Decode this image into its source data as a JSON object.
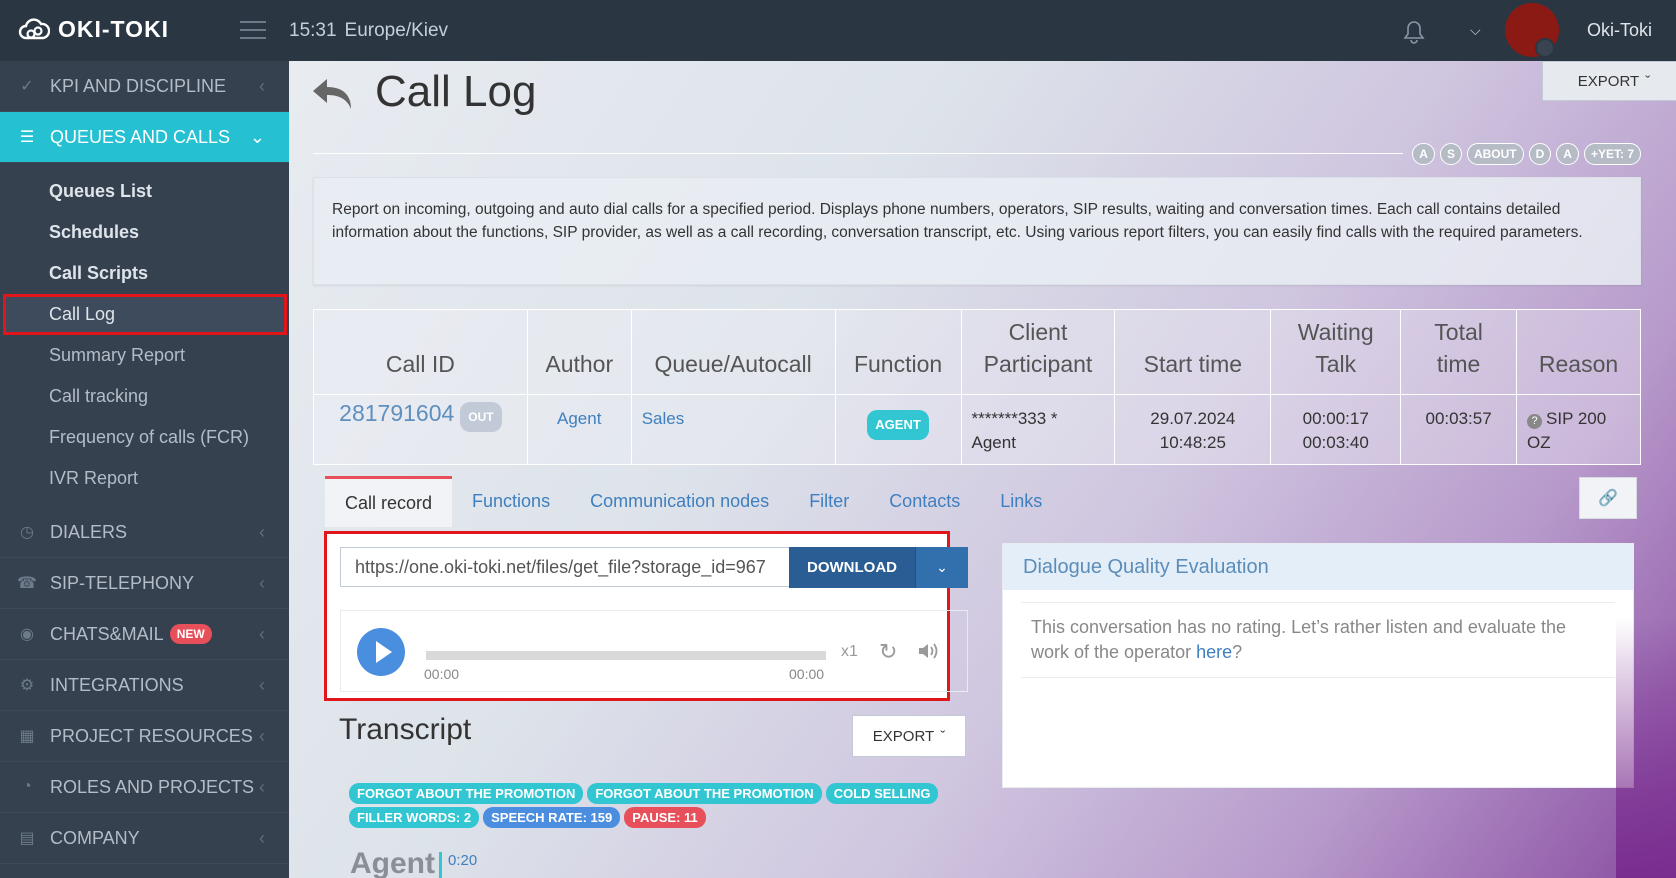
{
  "header": {
    "logo": "OKI-TOKI",
    "time": "15:31",
    "timezone": "Europe/Kiev",
    "username": "Oki-Toki"
  },
  "sidebar": {
    "items": [
      {
        "label": "KPI AND DISCIPLINE",
        "icon": "check-icon"
      },
      {
        "label": "QUEUES AND CALLS",
        "icon": "list-icon",
        "active": true
      },
      {
        "label": "DIALERS",
        "icon": "clock-icon"
      },
      {
        "label": "SIP-TELEPHONY",
        "icon": "phone-icon"
      },
      {
        "label": "CHATS&MAIL",
        "icon": "chat-icon",
        "badge": "NEW"
      },
      {
        "label": "INTEGRATIONS",
        "icon": "gears-icon"
      },
      {
        "label": "PROJECT RESOURCES",
        "icon": "grid-icon"
      },
      {
        "label": "ROLES AND PROJECTS",
        "icon": "toggle-icon"
      },
      {
        "label": "COMPANY",
        "icon": "bar-chart-icon"
      }
    ],
    "subitems": [
      {
        "label": "Queues List",
        "bold": true
      },
      {
        "label": "Schedules",
        "bold": true
      },
      {
        "label": "Call Scripts",
        "bold": true
      },
      {
        "label": "Call Log",
        "current": true
      },
      {
        "label": "Summary Report"
      },
      {
        "label": "Call tracking"
      },
      {
        "label": "Frequency of calls (FCR)"
      },
      {
        "label": "IVR Report"
      }
    ]
  },
  "page": {
    "title": "Call Log",
    "export_label": "EXPORT",
    "pills": [
      "A",
      "S",
      "ABOUT",
      "D",
      "A",
      "+YET: 7"
    ],
    "description": "Report on incoming, outgoing and auto dial calls for a specified period. Displays phone numbers, operators, SIP results, waiting and conversation times. Each call contains detailed information about the functions, SIP provider, as well as a call recording, conversation transcript, etc. Using various report filters, you can easily find calls with the required parameters."
  },
  "table": {
    "headers": {
      "call_id": "Call ID",
      "author": "Author",
      "queue": "Queue/Autocall",
      "function": "Function",
      "client_1": "Client",
      "client_2": "Participant",
      "start": "Start time",
      "waiting_1": "Waiting",
      "waiting_2": "Talk",
      "total_1": "Total",
      "total_2": "time",
      "reason": "Reason"
    },
    "row": {
      "call_id": "281791604",
      "direction": "OUT",
      "author": "Agent",
      "queue": "Sales",
      "function": "AGENT",
      "client": "*******333 *",
      "participant": "Agent",
      "start_date": "29.07.2024",
      "start_time": "10:48:25",
      "waiting": "00:00:17",
      "talk": "00:03:40",
      "total": "00:03:57",
      "reason_1": "SIP 200",
      "reason_2": "OZ"
    }
  },
  "tabs": [
    "Call record",
    "Functions",
    "Communication nodes",
    "Filter",
    "Contacts",
    "Links"
  ],
  "player": {
    "url": "https://one.oki-toki.net/files/get_file?storage_id=967",
    "download_label": "DOWNLOAD",
    "time_start": "00:00",
    "time_end": "00:00",
    "speed": "x1"
  },
  "quality": {
    "title": "Dialogue Quality Evaluation",
    "text": "This conversation has no rating. Let’s rather listen and evaluate the work of the operator ",
    "link": "here",
    "suffix": "?"
  },
  "transcript": {
    "title": "Transcript",
    "export_label": "EXPORT",
    "tags": [
      {
        "label": "FORGOT ABOUT THE PROMOTION",
        "color": "teal"
      },
      {
        "label": "FORGOT ABOUT THE PROMOTION",
        "color": "teal"
      },
      {
        "label": "COLD SELLING",
        "color": "teal"
      },
      {
        "label": "FILLER WORDS: 2",
        "color": "teal"
      },
      {
        "label": "SPEECH RATE: 159",
        "color": "blue"
      },
      {
        "label": "PAUSE: 11",
        "color": "red"
      }
    ],
    "speaker": "Agent",
    "speaker_time": "0:20"
  },
  "colors": {
    "sidebar_bg": "#364150",
    "header_bg": "#2b3643",
    "active_item": "#26c0d3",
    "highlight_outline": "#e0161b",
    "download_btn": "#2a5d93"
  }
}
